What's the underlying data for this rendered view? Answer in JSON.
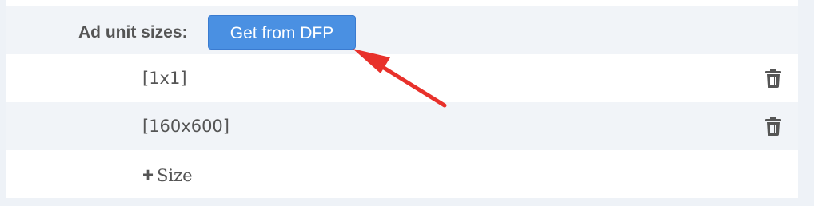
{
  "header": {
    "label": "Ad unit sizes:",
    "get_button_label": "Get from DFP"
  },
  "sizes": [
    {
      "label": "[1x1]"
    },
    {
      "label": "[160x600]"
    }
  ],
  "add_size_label": "Size",
  "icons": {
    "delete": "trash-icon",
    "add": "plus-icon",
    "annotation": "red-arrow"
  },
  "colors": {
    "button": "#4a90e2",
    "arrow": "#e8312b",
    "text": "#555555"
  }
}
